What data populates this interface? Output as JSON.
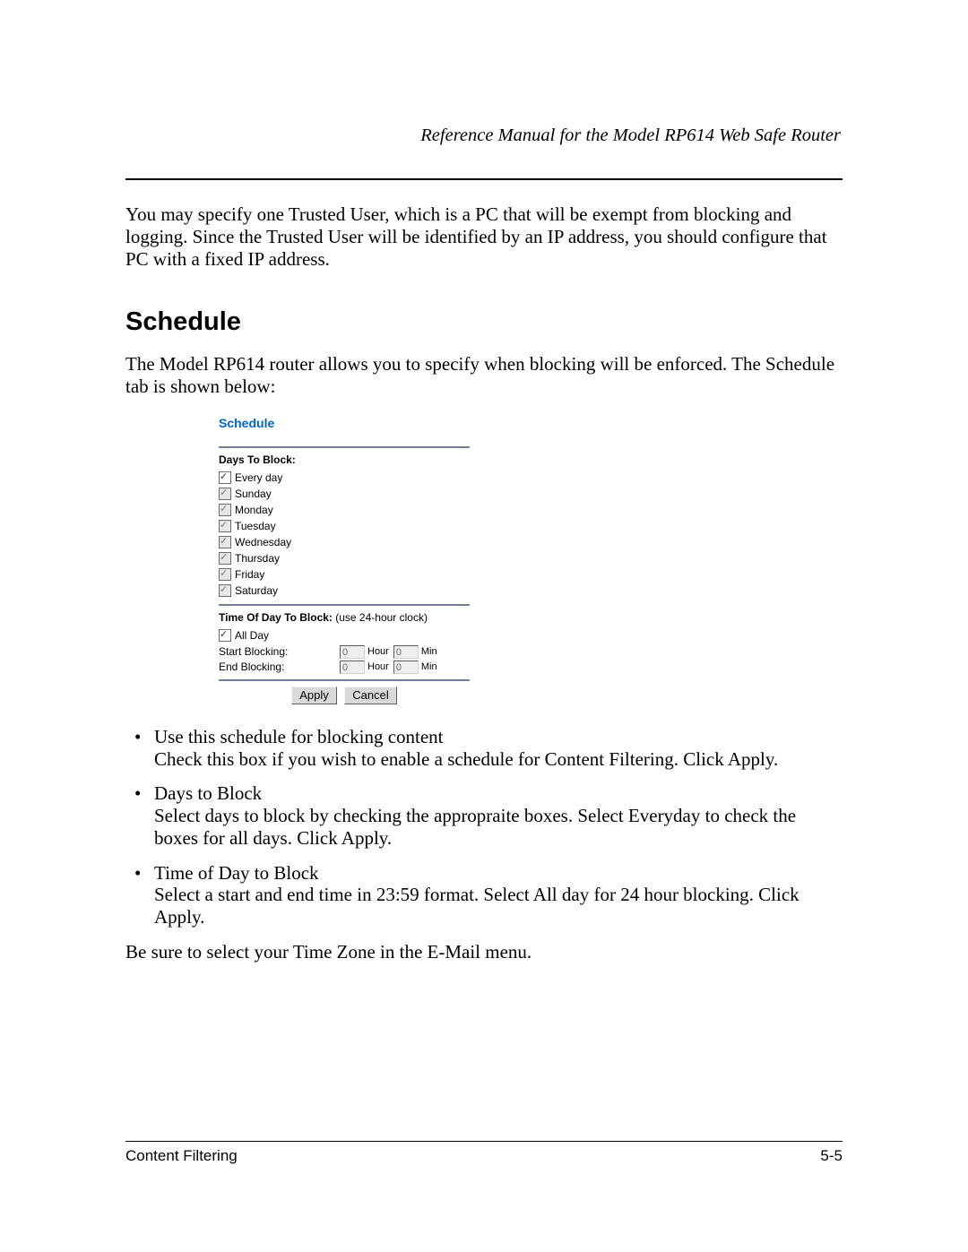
{
  "header": {
    "title": "Reference Manual for the Model RP614 Web Safe Router"
  },
  "intro_para": "You may specify one Trusted User, which is a PC that will be exempt from blocking and logging. Since the Trusted User will be identified by an IP address, you should configure that PC with a fixed IP address.",
  "section_heading": "Schedule",
  "section_intro": "The Model RP614 router allows you to specify when blocking will be enforced. The Schedule tab is shown below:",
  "ui": {
    "title": "Schedule",
    "days_heading": "Days To Block:",
    "days": [
      {
        "label": "Every day",
        "checked": true,
        "enabled": true
      },
      {
        "label": "Sunday",
        "checked": true,
        "enabled": false
      },
      {
        "label": "Monday",
        "checked": true,
        "enabled": false
      },
      {
        "label": "Tuesday",
        "checked": true,
        "enabled": false
      },
      {
        "label": "Wednesday",
        "checked": true,
        "enabled": false
      },
      {
        "label": "Thursday",
        "checked": true,
        "enabled": false
      },
      {
        "label": "Friday",
        "checked": true,
        "enabled": false
      },
      {
        "label": "Saturday",
        "checked": true,
        "enabled": false
      }
    ],
    "time_heading_bold": "Time Of Day To Block:",
    "time_heading_thin": " (use 24-hour clock)",
    "all_day": {
      "label": "All Day",
      "checked": true,
      "enabled": true
    },
    "rows": [
      {
        "label": "Start Blocking:",
        "hour": "0",
        "hour_unit": "Hour",
        "min": "0",
        "min_unit": "Min"
      },
      {
        "label": "End Blocking:",
        "hour": "0",
        "hour_unit": "Hour",
        "min": "0",
        "min_unit": "Min"
      }
    ],
    "buttons": {
      "apply": "Apply",
      "cancel": "Cancel"
    }
  },
  "bullets": [
    {
      "title": "Use this schedule for blocking content",
      "body": "Check this box if you wish to enable a schedule for Content Filtering. Click Apply."
    },
    {
      "title": "Days to Block",
      "body": "Select days to block by checking the appropraite boxes. Select Everyday to check the boxes for all days. Click Apply."
    },
    {
      "title": "Time of Day to Block",
      "body": "Select a start and end time in 23:59 format. Select All day for 24 hour blocking. Click Apply."
    }
  ],
  "closing_para": "Be sure to select your Time Zone in the E-Mail menu.",
  "footer": {
    "left": "Content Filtering",
    "right": "5-5"
  }
}
